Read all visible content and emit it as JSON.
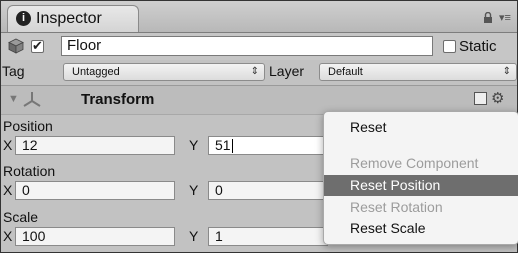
{
  "tab": {
    "title": "Inspector"
  },
  "object": {
    "name": "Floor",
    "active": true,
    "static_label": "Static",
    "static": false
  },
  "tag_row": {
    "tag_label": "Tag",
    "tag_value": "Untagged",
    "layer_label": "Layer",
    "layer_value": "Default"
  },
  "component": {
    "title": "Transform"
  },
  "position": {
    "label": "Position",
    "x_label": "X",
    "x": "12",
    "y_label": "Y",
    "y": "51"
  },
  "rotation": {
    "label": "Rotation",
    "x_label": "X",
    "x": "0",
    "y_label": "Y",
    "y": "0"
  },
  "scale": {
    "label": "Scale",
    "x_label": "X",
    "x": "100",
    "y_label": "Y",
    "y": "1"
  },
  "context_menu": {
    "items": [
      {
        "label": "Reset",
        "enabled": true,
        "selected": false
      },
      {
        "label": "Remove Component",
        "enabled": false,
        "selected": false
      },
      {
        "label": "Reset Position",
        "enabled": true,
        "selected": true
      },
      {
        "label": "Reset Rotation",
        "enabled": false,
        "selected": false
      },
      {
        "label": "Reset Scale",
        "enabled": true,
        "selected": false
      }
    ]
  },
  "icons": {
    "info": "info-icon",
    "lock": "lock-icon",
    "tab_menu": "tab-menu-icon",
    "gameobject": "cube-icon",
    "fold": "fold-arrow-icon",
    "transform": "transform-icon",
    "help": "help-icon",
    "settings": "gear-icon"
  },
  "colors": {
    "selected_highlight": "#6e6e6e",
    "panel_bg": "#c2c2c2"
  }
}
